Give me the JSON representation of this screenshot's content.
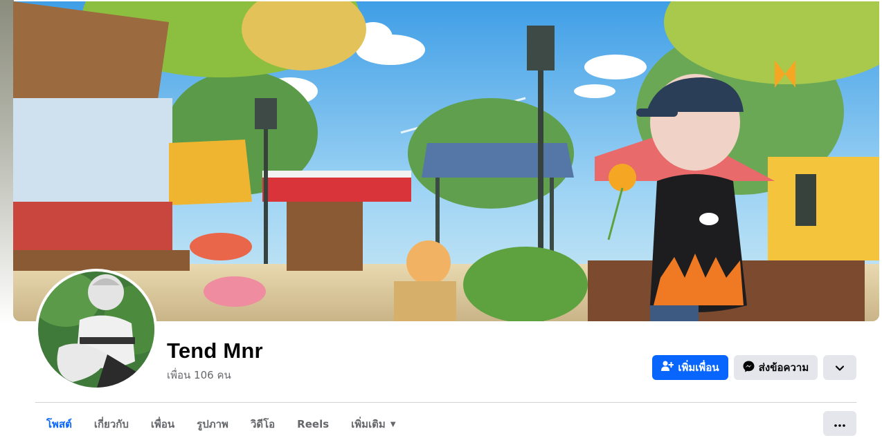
{
  "profile": {
    "name": "Tend Mnr",
    "friends_count": "เพื่อน 106 คน"
  },
  "actions": {
    "add_friend": "เพิ่มเพื่อน",
    "message": "ส่งข้อความ",
    "chevron_icon": "chevron-down-icon",
    "more_icon": "more-horizontal-icon"
  },
  "tabs": [
    {
      "label": "โพสต์",
      "active": true
    },
    {
      "label": "เกี่ยวกับ",
      "active": false
    },
    {
      "label": "เพื่อน",
      "active": false
    },
    {
      "label": "รูปภาพ",
      "active": false
    },
    {
      "label": "วิดีโอ",
      "active": false
    },
    {
      "label": "Reels",
      "active": false
    },
    {
      "label": "เพิ่มเติม",
      "active": false
    }
  ],
  "colors": {
    "accent": "#0866ff",
    "secondary_button": "#e4e6eb",
    "muted_text": "#65676b"
  }
}
